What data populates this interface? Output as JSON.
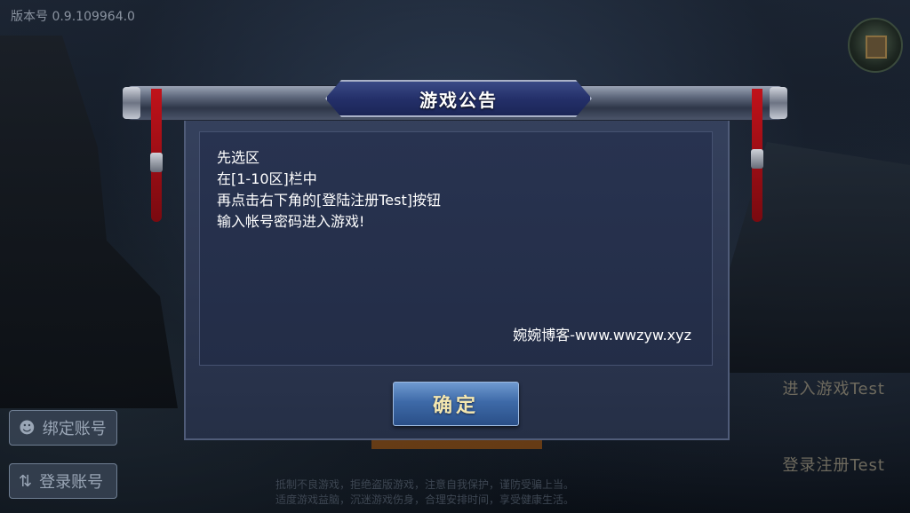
{
  "version_text": "版本号 0.9.109964.0",
  "dialog": {
    "title": "游戏公告",
    "lines": [
      "先选区",
      "在[1-10区]栏中",
      "再点击右下角的[登陆注册Test]按钮",
      "输入帐号密码进入游戏!"
    ],
    "signature": "婉婉博客-www.wwzyw.xyz",
    "confirm_label": "确定"
  },
  "side_buttons": {
    "bind_label": "绑定账号",
    "login_label": "登录账号"
  },
  "right_buttons": {
    "enter_label": "进入游戏Test",
    "register_label": "登录注册Test"
  },
  "notice": {
    "line1": "抵制不良游戏，拒绝盗版游戏，注意自我保护，谨防受骗上当。",
    "line2": "适度游戏益脑，沉迷游戏伤身，合理安排时间，享受健康生活。"
  },
  "icons": {
    "bind": "user-icon",
    "login": "swap-icon",
    "corner": "house-icon"
  },
  "colors": {
    "title_plate": "#24306a",
    "confirm_button": "#3e6aa8",
    "tassel": "#c0121a"
  }
}
